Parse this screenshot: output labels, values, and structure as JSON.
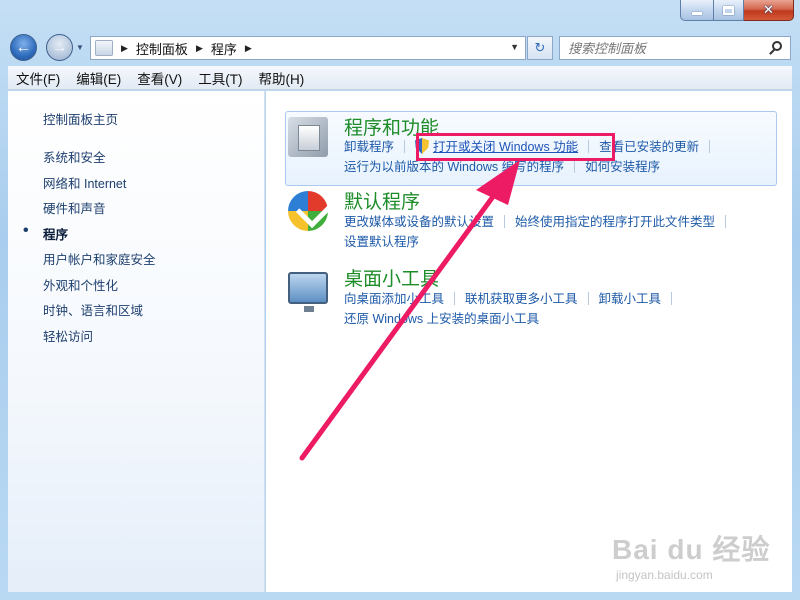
{
  "window": {
    "controls": {
      "minimize": "minimize",
      "maximize": "maximize",
      "close_glyph": "✕"
    }
  },
  "nav": {
    "back_glyph": "←",
    "forward_glyph": "→",
    "breadcrumbs": [
      "控制面板",
      "程序"
    ],
    "refresh_glyph": "↻"
  },
  "search": {
    "placeholder": "搜索控制面板"
  },
  "menu": [
    "文件(F)",
    "编辑(E)",
    "查看(V)",
    "工具(T)",
    "帮助(H)"
  ],
  "sidebar": {
    "home": "控制面板主页",
    "items": [
      {
        "label": "系统和安全",
        "active": false
      },
      {
        "label": "网络和 Internet",
        "active": false
      },
      {
        "label": "硬件和声音",
        "active": false
      },
      {
        "label": "程序",
        "active": true
      },
      {
        "label": "用户帐户和家庭安全",
        "active": false
      },
      {
        "label": "外观和个性化",
        "active": false
      },
      {
        "label": "时钟、语言和区域",
        "active": false
      },
      {
        "label": "轻松访问",
        "active": false
      }
    ]
  },
  "categories": {
    "programs": {
      "title": "程序和功能",
      "links": [
        "卸载程序",
        "打开或关闭 Windows 功能",
        "查看已安装的更新",
        "运行为以前版本的 Windows 编写的程序",
        "如何安装程序"
      ]
    },
    "default": {
      "title": "默认程序",
      "links": [
        "更改媒体或设备的默认设置",
        "始终使用指定的程序打开此文件类型",
        "设置默认程序"
      ]
    },
    "gadgets": {
      "title": "桌面小工具",
      "links": [
        "向桌面添加小工具",
        "联机获取更多小工具",
        "卸载小工具",
        "还原 Windows 上安装的桌面小工具"
      ]
    }
  },
  "annotation": {
    "highlight_color": "#ec1b63"
  },
  "watermark": {
    "main": "Bai du 经验",
    "sub": "jingyan.baidu.com"
  }
}
